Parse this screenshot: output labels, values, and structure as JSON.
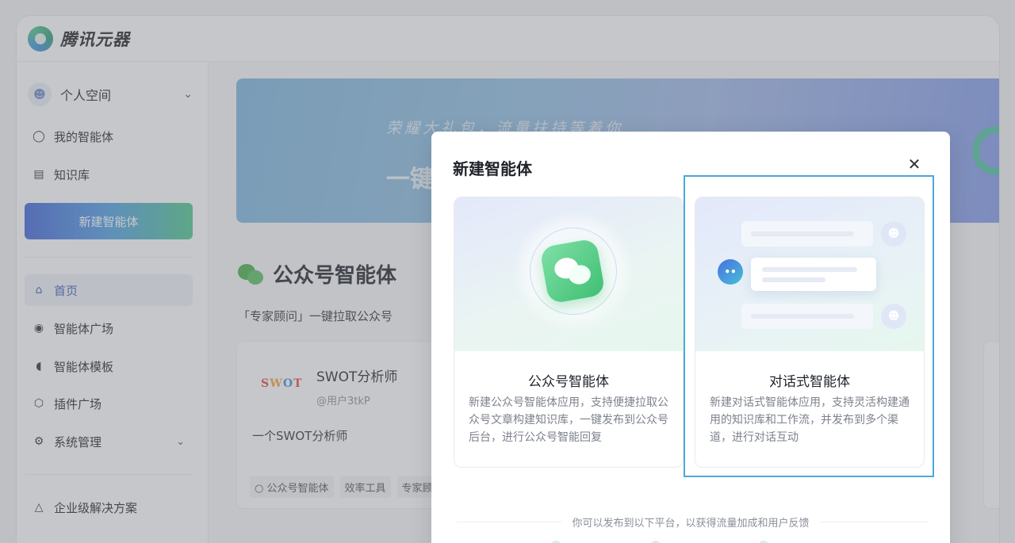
{
  "app": {
    "title": "腾讯元器"
  },
  "sidebar": {
    "space_label": "个人空间",
    "items_top": [
      {
        "label": "我的智能体",
        "icon": "agent-icon"
      },
      {
        "label": "知识库",
        "icon": "document-icon"
      }
    ],
    "new_button": "新建智能体",
    "items_main": [
      {
        "label": "首页",
        "icon": "home-icon",
        "active": true
      },
      {
        "label": "智能体广场",
        "icon": "plaza-icon"
      },
      {
        "label": "智能体模板",
        "icon": "template-icon"
      },
      {
        "label": "插件广场",
        "icon": "plugin-icon"
      },
      {
        "label": "系统管理",
        "icon": "settings-icon"
      }
    ],
    "enterprise": {
      "label": "企业级解决方案",
      "icon": "enterprise-icon"
    }
  },
  "main": {
    "banner": {
      "slogan": "荣耀大礼包，流量扶持等着你",
      "big": "一键"
    },
    "section_title": "公众号智能体",
    "section_sub": "「专家顾问」一键拉取公众号",
    "card": {
      "logo_text": "SWOT",
      "title": "SWOT分析师",
      "author": "@用户3tkP",
      "desc": "一个SWOT分析师",
      "tags": [
        "公众号智能体",
        "效率工具",
        "专家顾"
      ]
    }
  },
  "modal": {
    "title": "新建智能体",
    "close_icon": "close-icon",
    "options": [
      {
        "title": "公众号智能体",
        "desc": "新建公众号智能体应用，支持便捷拉取公众号文章构建知识库，一键发布到公众号后台，进行公众号智能回复"
      },
      {
        "title": "对话式智能体",
        "desc": "新建对话式智能体应用，支持灵活构建通用的知识库和工作流，并发布到多个渠道，进行对话互动"
      }
    ],
    "footer": "你可以发布到以下平台，以获得流量加成和用户反馈"
  },
  "colors": {
    "accent": "#3f5fb8",
    "brand_green": "#47b04b",
    "selection": "#4aa9d8"
  }
}
